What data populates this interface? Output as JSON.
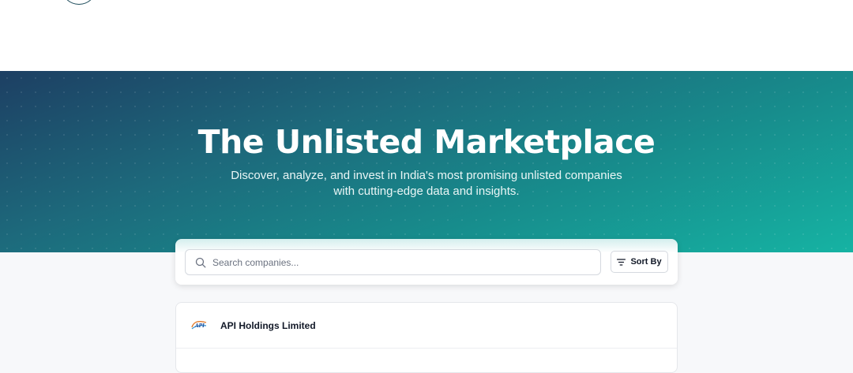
{
  "hero": {
    "title": "The Unlisted Marketplace",
    "subtitle_line1": "Discover, analyze, and invest in India's most promising unlisted companies",
    "subtitle_line2": "with cutting-edge data and insights."
  },
  "search": {
    "placeholder": "Search companies...",
    "value": "",
    "icon": "search-icon"
  },
  "sort": {
    "label": "Sort By",
    "icon": "filter-icon"
  },
  "companies": [
    {
      "name": "API Holdings Limited",
      "logo_text": "API"
    }
  ],
  "colors": {
    "hero_start": "#1d3f63",
    "hero_end": "#16b3a3",
    "page_bg": "#f7f8fa"
  }
}
